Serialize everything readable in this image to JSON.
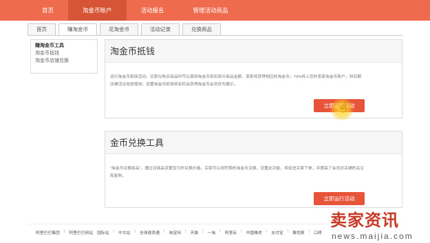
{
  "topnav": {
    "items": [
      {
        "label": "首页"
      },
      {
        "label": "淘金币账户"
      },
      {
        "label": "活动报名"
      },
      {
        "label": "管理活动商品"
      }
    ]
  },
  "tabs": [
    {
      "label": "首页"
    },
    {
      "label": "赚淘金币"
    },
    {
      "label": "花淘金币"
    },
    {
      "label": "活动记录"
    },
    {
      "label": "兑换商品"
    }
  ],
  "sidebar": {
    "title": "赚淘金币工具",
    "links": [
      {
        "label": "淘金币抵钱"
      },
      {
        "label": "淘金币店铺兑换"
      }
    ]
  },
  "card1": {
    "title": "淘金币抵钱",
    "desc": "运行淘金币抵钱活动，买家在购买商品时可以使用淘金币抵扣部分商品金额，卖家将获得相应的淘金币，70%将入您的卖家淘金币账户，供后期店铺活动发放使用；设置淘金币抵钱将有机会获得淘金币会员优先展示。",
    "button": "立即运行活动"
  },
  "card2": {
    "title": "金币兑换工具",
    "desc": "“淘金币兑换商品”，通过对商品设置宝贝的兑换价格，买家可以用积攒的淘金币兑换，设置此功能，将促进买家下单，并提高了会员对店铺的关注和复购。",
    "button": "立即运行活动"
  },
  "footer": {
    "links": [
      "阿里巴巴集团",
      "阿里巴巴网站",
      "国际站",
      "中文站",
      "全球速卖通",
      "淘宝网",
      "天猫",
      "一淘",
      "阿里云",
      "中国雅虎",
      "支付宝",
      "聚划算",
      "口碑"
    ]
  },
  "watermark": {
    "main": "卖家资讯",
    "sub": "news.maijia.com"
  }
}
